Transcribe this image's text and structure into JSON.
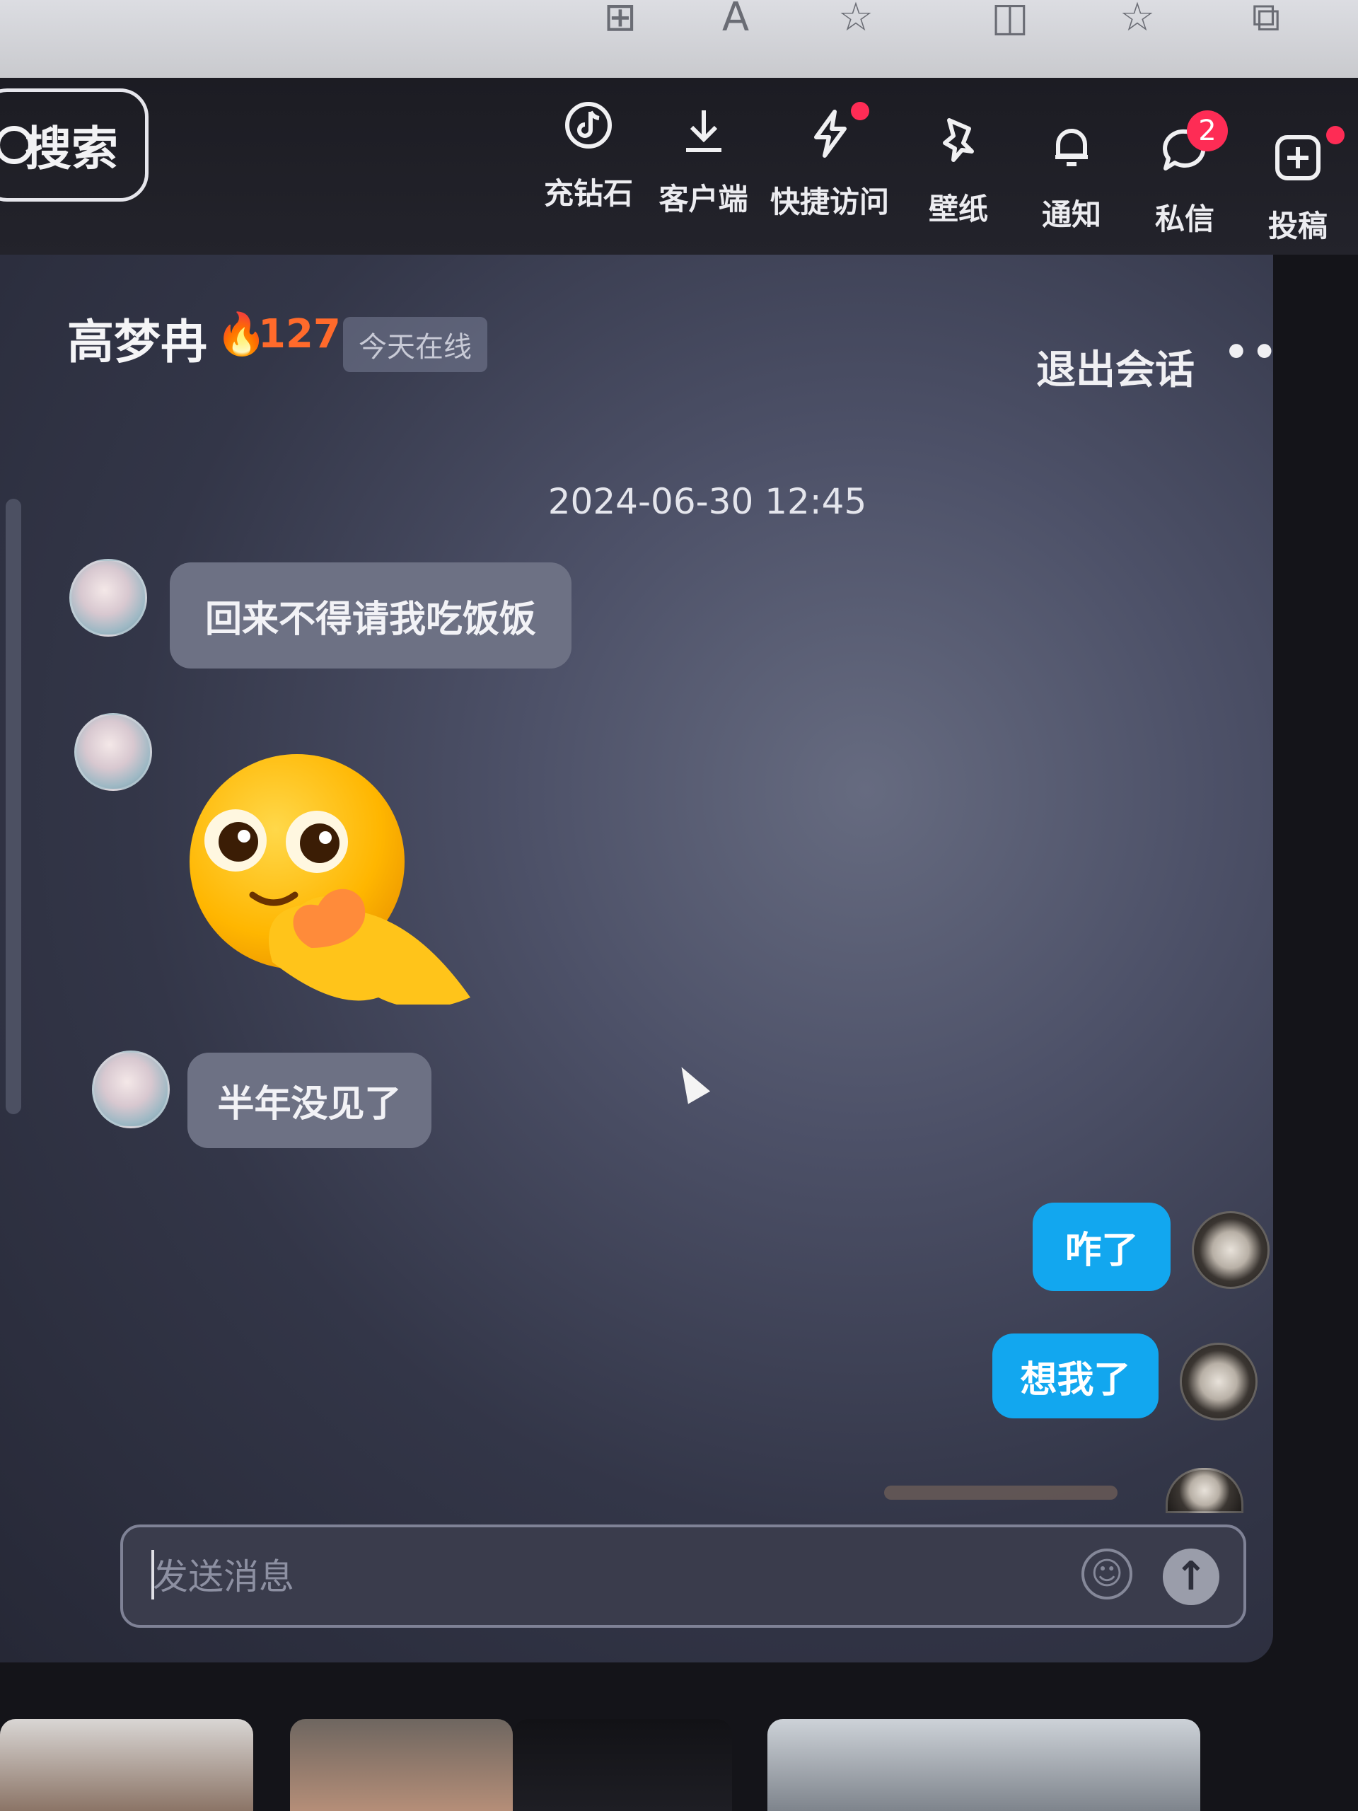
{
  "browser_toolbar": {
    "icons": [
      "grid-icon",
      "read-aloud-icon",
      "favorite-star-icon",
      "split-screen-icon",
      "favorites-list-icon",
      "add-collection-icon"
    ]
  },
  "search": {
    "label": "搜索"
  },
  "nav": {
    "items": [
      {
        "label": "充钻石",
        "icon": "tiktok-diamond-icon"
      },
      {
        "label": "客户端",
        "icon": "download-icon"
      },
      {
        "label": "快捷访问",
        "icon": "lightning-icon"
      },
      {
        "label": "壁纸",
        "icon": "wallpaper-pin-icon"
      },
      {
        "label": "通知",
        "icon": "bell-icon"
      },
      {
        "label": "私信",
        "icon": "message-icon"
      },
      {
        "label": "投稿",
        "icon": "upload-plus-icon"
      }
    ],
    "message_badge": "2"
  },
  "chat": {
    "contact_name": "高梦冉",
    "streak_count": "127",
    "online_status": "今天在线",
    "exit_label": "退出会话",
    "more_label": "•••",
    "close_label": "✕",
    "timestamp": "2024-06-30 12:45",
    "messages": [
      {
        "from": "them",
        "type": "text",
        "text": "回来不得请我吃饭饭"
      },
      {
        "from": "them",
        "type": "sticker",
        "sticker": "heart-hands-smiley-sticker"
      },
      {
        "from": "them",
        "type": "text",
        "text": "半年没见了"
      },
      {
        "from": "me",
        "type": "text",
        "text": "咋了"
      },
      {
        "from": "me",
        "type": "text",
        "text": "想我了"
      }
    ]
  },
  "composer": {
    "placeholder": "发送消息",
    "emoji_icon": "emoji-icon",
    "send_icon": "send-arrow-icon"
  },
  "colors": {
    "accent_blue": "#12a7ef",
    "badge_red": "#fe2c55",
    "streak_orange": "#ff6a2b",
    "bubble_gray": "#6d7184"
  }
}
